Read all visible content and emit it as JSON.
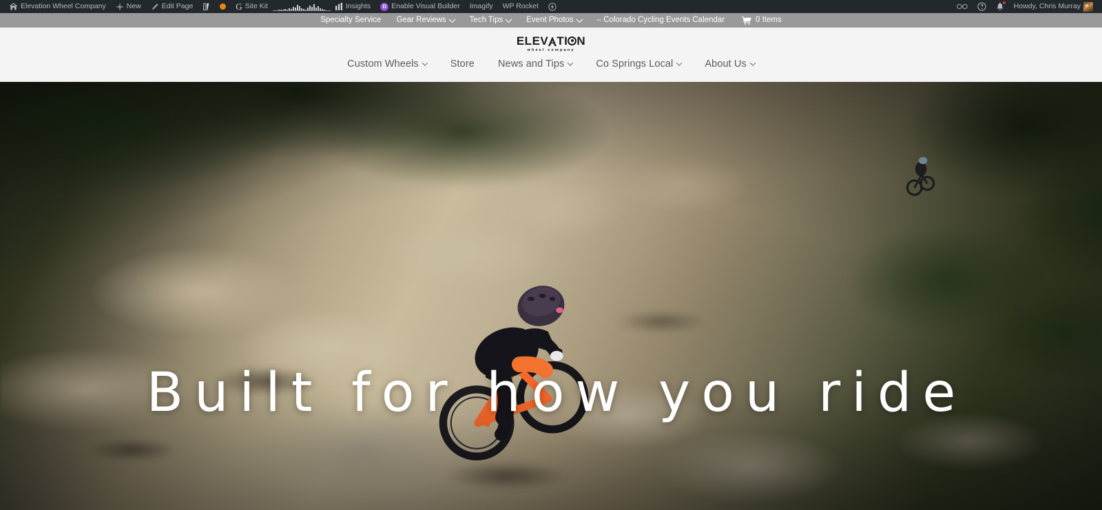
{
  "adminbar": {
    "left_items": [
      {
        "icon": "wordpress-home-icon",
        "label": "Elevation Wheel Company"
      },
      {
        "icon": "plus-icon",
        "label": "New"
      },
      {
        "icon": "pencil-icon",
        "label": "Edit Page"
      },
      {
        "icon": "yoast-seo-icon",
        "label": ""
      },
      {
        "icon": "orange-dot-icon",
        "label": ""
      },
      {
        "icon": "google-g-icon",
        "label": "Site Kit"
      },
      {
        "icon": "sparkline-chart-icon",
        "label": ""
      },
      {
        "icon": "bar-chart-icon",
        "label": "Insights"
      },
      {
        "icon": "divi-d-icon",
        "label": "Enable Visual Builder"
      },
      {
        "icon": "",
        "label": "Imagify"
      },
      {
        "icon": "",
        "label": "WP Rocket"
      },
      {
        "icon": "rocket-bolt-icon",
        "label": ""
      }
    ],
    "right_items": [
      {
        "icon": "glasses-icon",
        "label": ""
      },
      {
        "icon": "help-icon",
        "label": ""
      },
      {
        "icon": "bell-icon",
        "label": ""
      },
      {
        "icon": "avatar",
        "label": "Howdy, Chris Murray"
      }
    ],
    "colors": {
      "background": "#23282d",
      "text": "#b4b9be"
    }
  },
  "secondary_nav": {
    "items": [
      {
        "label": "Specialty Service",
        "has_dropdown": false
      },
      {
        "label": "Gear Reviews",
        "has_dropdown": true
      },
      {
        "label": "Tech Tips",
        "has_dropdown": true
      },
      {
        "label": "Event Photos",
        "has_dropdown": true
      },
      {
        "label": "– Colorado Cycling Events Calendar",
        "has_dropdown": false
      }
    ],
    "cart": {
      "icon": "shopping-cart-icon",
      "label": "0 Items"
    },
    "colors": {
      "background": "#999999",
      "text": "#ffffff"
    }
  },
  "header": {
    "logo": {
      "part1": "ELEV",
      "peak_letter": "A",
      "part2": "TI",
      "wheel_letter": "O",
      "part3": "N",
      "tagline": "wheel company"
    },
    "nav": [
      {
        "label": "Custom Wheels",
        "has_dropdown": true
      },
      {
        "label": "Store",
        "has_dropdown": false
      },
      {
        "label": "News and Tips",
        "has_dropdown": true
      },
      {
        "label": "Co Springs Local",
        "has_dropdown": true
      },
      {
        "label": "About Us",
        "has_dropdown": true
      }
    ],
    "colors": {
      "background": "#f4f4f4",
      "nav_text": "#5b5b5b"
    }
  },
  "hero": {
    "headline": "Built for how you ride",
    "alt": "Mountain biker descending a rocky trail",
    "text_color": "#ffffff"
  }
}
